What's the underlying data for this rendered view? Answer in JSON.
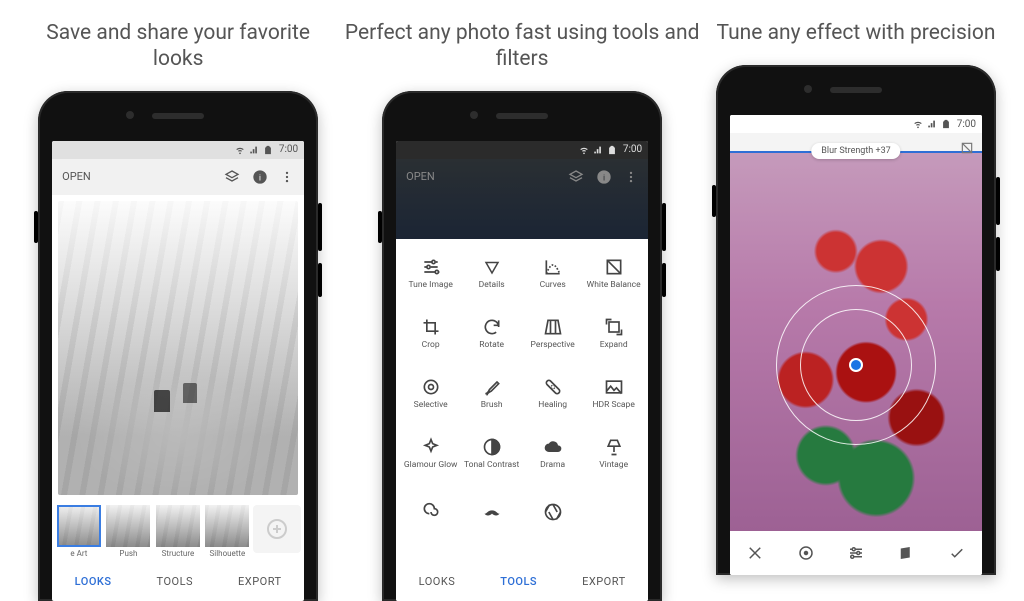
{
  "captions": {
    "panel1": "Save and share your favorite looks",
    "panel2": "Perfect any photo fast using tools and filters",
    "panel3": "Tune any effect with precision"
  },
  "statusbar": {
    "time": "7:00"
  },
  "screen1": {
    "open_label": "OPEN",
    "looks": [
      "e Art",
      "Push",
      "Structure",
      "Silhouette"
    ],
    "selected_look_index": 0,
    "tabs": {
      "looks": "LOOKS",
      "tools": "TOOLS",
      "export": "EXPORT",
      "active": "looks"
    }
  },
  "screen2": {
    "open_label": "OPEN",
    "tools": [
      "Tune Image",
      "Details",
      "Curves",
      "White Balance",
      "Crop",
      "Rotate",
      "Perspective",
      "Expand",
      "Selective",
      "Brush",
      "Healing",
      "HDR Scape",
      "Glamour Glow",
      "Tonal Contrast",
      "Drama",
      "Vintage",
      "",
      "",
      ""
    ],
    "tabs": {
      "looks": "LOOKS",
      "tools": "TOOLS",
      "export": "EXPORT",
      "active": "tools"
    }
  },
  "screen3": {
    "param_label": "Blur Strength +37"
  }
}
